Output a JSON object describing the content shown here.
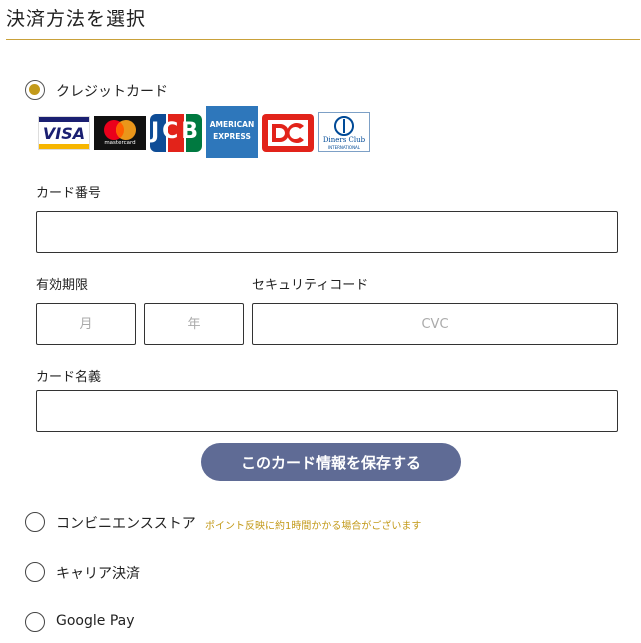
{
  "header": {
    "title": "決済方法を選択"
  },
  "payment_methods": {
    "credit_card": {
      "label": "クレジットカード",
      "selected": true
    },
    "convenience": {
      "label": "コンビニエンスストア",
      "note": "ポイント反映に約1時間かかる場合がございます"
    },
    "carrier": {
      "label": "キャリア決済"
    },
    "google_pay": {
      "label": "Google Pay"
    }
  },
  "brands": {
    "visa": "VISA",
    "mastercard": "mastercard",
    "jcb": "JCB",
    "amex_top": "AMERICAN",
    "amex_bottom": "EXPRESS",
    "diners_top": "Diners Club",
    "diners_bottom": "INTERNATIONAL"
  },
  "form": {
    "card_number": {
      "label": "カード番号",
      "value": "",
      "placeholder": ""
    },
    "expiry": {
      "label": "有効期限",
      "month_placeholder": "月",
      "year_placeholder": "年"
    },
    "security": {
      "label": "セキュリティコード",
      "placeholder": "CVC"
    },
    "cardholder": {
      "label": "カード名義",
      "value": "",
      "placeholder": ""
    },
    "save_button": "このカード情報を保存する"
  },
  "colors": {
    "accent": "#c39a1a",
    "button": "#5f6b95",
    "rule": "#c9a13a"
  }
}
